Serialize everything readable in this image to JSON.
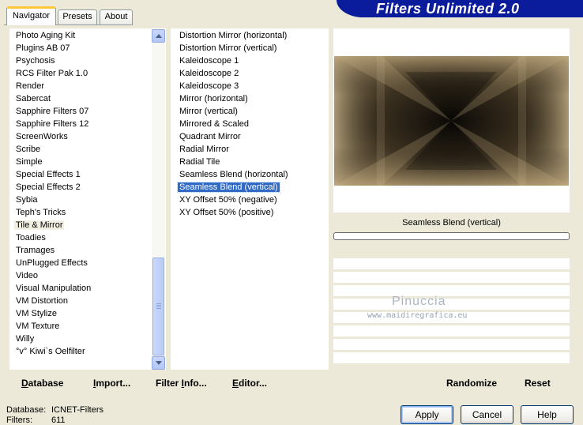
{
  "tabs": [
    {
      "label": "Navigator",
      "active": true
    },
    {
      "label": "Presets",
      "active": false
    },
    {
      "label": "About",
      "active": false
    }
  ],
  "banner_title": "Filters Unlimited 2.0",
  "categories": [
    "Photo Aging Kit",
    "Plugins AB 07",
    "Psychosis",
    "RCS Filter Pak 1.0",
    "Render",
    "Sabercat",
    "Sapphire Filters 07",
    "Sapphire Filters 12",
    "ScreenWorks",
    "Scribe",
    "Simple",
    "Special Effects 1",
    "Special Effects 2",
    "Sybia",
    "Teph's Tricks",
    "Tile & Mirror",
    "Toadies",
    "Tramages",
    "UnPlugged Effects",
    "Video",
    "Visual Manipulation",
    "VM Distortion",
    "VM Stylize",
    "VM Texture",
    "Willy",
    "°v° Kiwi`s Oelfilter"
  ],
  "selected_category": "Tile & Mirror",
  "filters": [
    "Distortion Mirror (horizontal)",
    "Distortion Mirror (vertical)",
    "Kaleidoscope 1",
    "Kaleidoscope 2",
    "Kaleidoscope 3",
    "Mirror (horizontal)",
    "Mirror (vertical)",
    "Mirrored & Scaled",
    "Quadrant Mirror",
    "Radial Mirror",
    "Radial Tile",
    "Seamless Blend (horizontal)",
    "Seamless Blend (vertical)",
    "XY Offset 50% (negative)",
    "XY Offset 50% (positive)"
  ],
  "selected_filter": "Seamless Blend (vertical)",
  "preview": {
    "filter_name": "Seamless Blend (vertical)",
    "progress": 0,
    "colors": {
      "dark": "#0b0906",
      "mid": "#3c3120",
      "light": "#d9c49c"
    }
  },
  "watermark": {
    "name": "Pinuccia",
    "site": "www.maidiregrafica.eu"
  },
  "bottom_links": {
    "database": {
      "accel": "D",
      "rest": "atabase"
    },
    "import": {
      "accel": "I",
      "rest": "mport..."
    },
    "filter_info": {
      "accel": "",
      "pre": "Filter ",
      "accel2": "I",
      "rest": "nfo..."
    },
    "editor": {
      "accel": "E",
      "rest": "ditor..."
    },
    "randomize": "Randomize",
    "reset": "Reset"
  },
  "status": {
    "database_label": "Database:",
    "database_value": "ICNET-Filters",
    "filters_label": "Filters:",
    "filters_value": "611"
  },
  "buttons": {
    "apply": "Apply",
    "cancel": "Cancel",
    "help": "Help"
  },
  "colors": {
    "banner": "#0a1b9b",
    "selection": "#316ac5",
    "face": "#ece9d8"
  }
}
